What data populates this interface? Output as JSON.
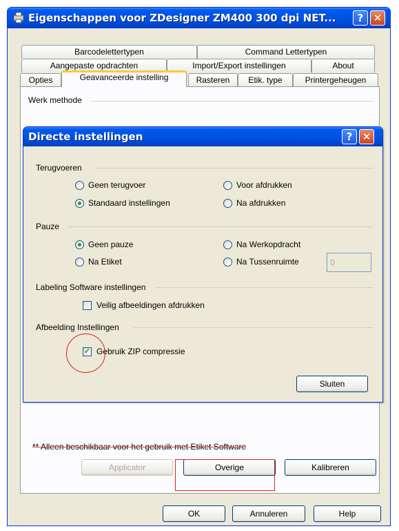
{
  "outer": {
    "title": "Eigenschappen voor ZDesigner ZM400 300 dpi NET...",
    "help_btn": "?",
    "close_btn": "✕",
    "tabs_row1": [
      "Barcodelettertypen",
      "Command Lettertypen"
    ],
    "tabs_row2": [
      "Aangepaste opdrachten",
      "Import/Export instellingen",
      "About"
    ],
    "tabs_row3": [
      "Opties",
      "Geavanceerde instelling",
      "Rasteren",
      "Etik. type",
      "Printergeheugen"
    ],
    "group_werk": "Werk methode",
    "footnote": "** Alleen beschikbaar voor het gebruik met Etiket Software",
    "btn_applicator": "Applicator",
    "btn_overige": "Overige",
    "btn_kalibreren": "Kalibreren",
    "btn_ok": "OK",
    "btn_annuleren": "Annuleren",
    "btn_help": "Help"
  },
  "inner": {
    "title": "Directe instellingen",
    "help_btn": "?",
    "close_btn": "✕",
    "terugvoeren": {
      "label": "Terugvoeren",
      "options": [
        "Geen terugvoer",
        "Voor afdrukken",
        "Standaard instellingen",
        "Na afdrukken"
      ],
      "selected": "Standaard instellingen"
    },
    "pauze": {
      "label": "Pauze",
      "options": [
        "Geen pauze",
        "Na Werkopdracht",
        "Na Etiket",
        "Na Tussenruimte"
      ],
      "selected": "Geen pauze",
      "tussenruimte_value": "0"
    },
    "labeling": {
      "label": "Labeling Software instellingen",
      "checkbox": "Veilig afbeeldingen afdrukken",
      "checked": false
    },
    "afbeelding": {
      "label": "Afbeelding Instellingen",
      "checkbox": "Gebruik ZIP compressie",
      "checked": true
    },
    "btn_sluiten": "Sluiten"
  },
  "colors": {
    "titlebar": "#0054e3",
    "dialog_bg": "#ece9d8",
    "annotation": "#e02020",
    "radio_dot": "#21a121"
  }
}
